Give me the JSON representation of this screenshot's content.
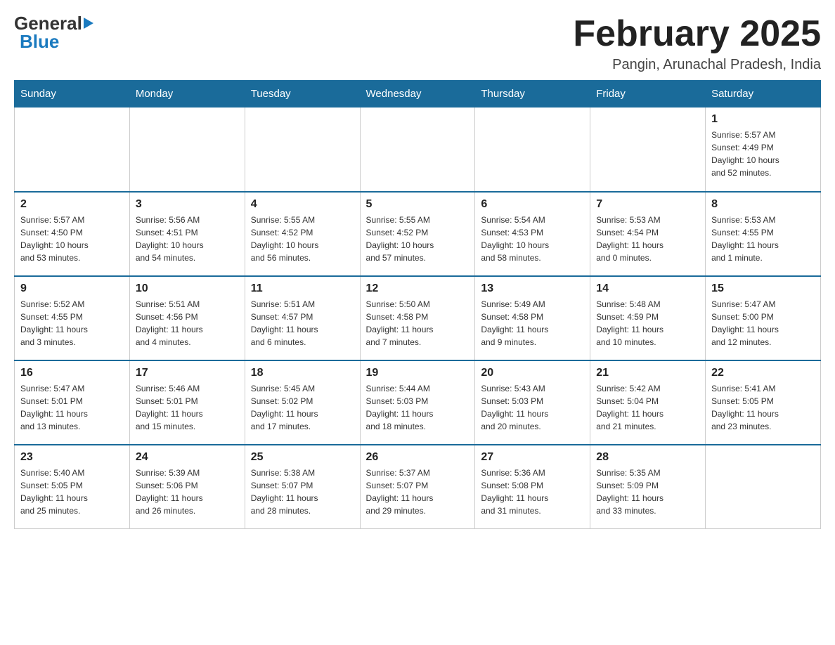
{
  "header": {
    "logo_general": "General",
    "logo_blue": "Blue",
    "month_title": "February 2025",
    "location": "Pangin, Arunachal Pradesh, India"
  },
  "weekdays": [
    "Sunday",
    "Monday",
    "Tuesday",
    "Wednesday",
    "Thursday",
    "Friday",
    "Saturday"
  ],
  "weeks": [
    [
      {
        "day": "",
        "info": ""
      },
      {
        "day": "",
        "info": ""
      },
      {
        "day": "",
        "info": ""
      },
      {
        "day": "",
        "info": ""
      },
      {
        "day": "",
        "info": ""
      },
      {
        "day": "",
        "info": ""
      },
      {
        "day": "1",
        "info": "Sunrise: 5:57 AM\nSunset: 4:49 PM\nDaylight: 10 hours\nand 52 minutes."
      }
    ],
    [
      {
        "day": "2",
        "info": "Sunrise: 5:57 AM\nSunset: 4:50 PM\nDaylight: 10 hours\nand 53 minutes."
      },
      {
        "day": "3",
        "info": "Sunrise: 5:56 AM\nSunset: 4:51 PM\nDaylight: 10 hours\nand 54 minutes."
      },
      {
        "day": "4",
        "info": "Sunrise: 5:55 AM\nSunset: 4:52 PM\nDaylight: 10 hours\nand 56 minutes."
      },
      {
        "day": "5",
        "info": "Sunrise: 5:55 AM\nSunset: 4:52 PM\nDaylight: 10 hours\nand 57 minutes."
      },
      {
        "day": "6",
        "info": "Sunrise: 5:54 AM\nSunset: 4:53 PM\nDaylight: 10 hours\nand 58 minutes."
      },
      {
        "day": "7",
        "info": "Sunrise: 5:53 AM\nSunset: 4:54 PM\nDaylight: 11 hours\nand 0 minutes."
      },
      {
        "day": "8",
        "info": "Sunrise: 5:53 AM\nSunset: 4:55 PM\nDaylight: 11 hours\nand 1 minute."
      }
    ],
    [
      {
        "day": "9",
        "info": "Sunrise: 5:52 AM\nSunset: 4:55 PM\nDaylight: 11 hours\nand 3 minutes."
      },
      {
        "day": "10",
        "info": "Sunrise: 5:51 AM\nSunset: 4:56 PM\nDaylight: 11 hours\nand 4 minutes."
      },
      {
        "day": "11",
        "info": "Sunrise: 5:51 AM\nSunset: 4:57 PM\nDaylight: 11 hours\nand 6 minutes."
      },
      {
        "day": "12",
        "info": "Sunrise: 5:50 AM\nSunset: 4:58 PM\nDaylight: 11 hours\nand 7 minutes."
      },
      {
        "day": "13",
        "info": "Sunrise: 5:49 AM\nSunset: 4:58 PM\nDaylight: 11 hours\nand 9 minutes."
      },
      {
        "day": "14",
        "info": "Sunrise: 5:48 AM\nSunset: 4:59 PM\nDaylight: 11 hours\nand 10 minutes."
      },
      {
        "day": "15",
        "info": "Sunrise: 5:47 AM\nSunset: 5:00 PM\nDaylight: 11 hours\nand 12 minutes."
      }
    ],
    [
      {
        "day": "16",
        "info": "Sunrise: 5:47 AM\nSunset: 5:01 PM\nDaylight: 11 hours\nand 13 minutes."
      },
      {
        "day": "17",
        "info": "Sunrise: 5:46 AM\nSunset: 5:01 PM\nDaylight: 11 hours\nand 15 minutes."
      },
      {
        "day": "18",
        "info": "Sunrise: 5:45 AM\nSunset: 5:02 PM\nDaylight: 11 hours\nand 17 minutes."
      },
      {
        "day": "19",
        "info": "Sunrise: 5:44 AM\nSunset: 5:03 PM\nDaylight: 11 hours\nand 18 minutes."
      },
      {
        "day": "20",
        "info": "Sunrise: 5:43 AM\nSunset: 5:03 PM\nDaylight: 11 hours\nand 20 minutes."
      },
      {
        "day": "21",
        "info": "Sunrise: 5:42 AM\nSunset: 5:04 PM\nDaylight: 11 hours\nand 21 minutes."
      },
      {
        "day": "22",
        "info": "Sunrise: 5:41 AM\nSunset: 5:05 PM\nDaylight: 11 hours\nand 23 minutes."
      }
    ],
    [
      {
        "day": "23",
        "info": "Sunrise: 5:40 AM\nSunset: 5:05 PM\nDaylight: 11 hours\nand 25 minutes."
      },
      {
        "day": "24",
        "info": "Sunrise: 5:39 AM\nSunset: 5:06 PM\nDaylight: 11 hours\nand 26 minutes."
      },
      {
        "day": "25",
        "info": "Sunrise: 5:38 AM\nSunset: 5:07 PM\nDaylight: 11 hours\nand 28 minutes."
      },
      {
        "day": "26",
        "info": "Sunrise: 5:37 AM\nSunset: 5:07 PM\nDaylight: 11 hours\nand 29 minutes."
      },
      {
        "day": "27",
        "info": "Sunrise: 5:36 AM\nSunset: 5:08 PM\nDaylight: 11 hours\nand 31 minutes."
      },
      {
        "day": "28",
        "info": "Sunrise: 5:35 AM\nSunset: 5:09 PM\nDaylight: 11 hours\nand 33 minutes."
      },
      {
        "day": "",
        "info": ""
      }
    ]
  ]
}
